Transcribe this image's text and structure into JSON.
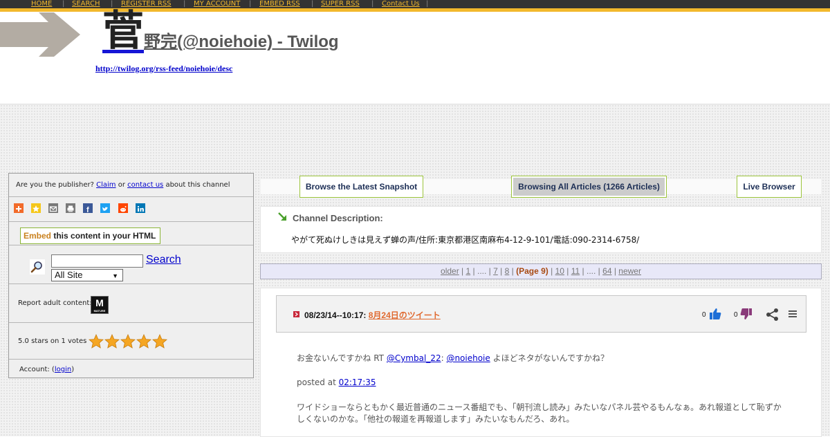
{
  "nav": {
    "items": [
      "HOME",
      "SEARCH",
      "REGISTER RSS",
      "MY ACCOUNT",
      "EMBED RSS",
      "SUPER RSS",
      "Contact Us"
    ]
  },
  "header": {
    "title_big_char": "菅",
    "title_rest": "野完(@noiehoie) - Twilog",
    "rss_url": "http://twilog.org/rss-feed/noiehoie/desc"
  },
  "sidebar": {
    "publisher_prefix": "Are you the publisher? ",
    "claim_link": "Claim",
    "or_text": " or ",
    "contact_link": "contact us",
    "publisher_suffix": " about this channel",
    "embed_word": "Embed",
    "embed_rest": " this content in your HTML",
    "search_value": "",
    "search_label": "Search",
    "site_select_value": "All Site",
    "report_label": "Report adult content:",
    "mature_label": "M",
    "mature_small": "MATURE",
    "rating_text": "5.0 stars on 1 votes",
    "rating_value": 5,
    "account_prefix": "Account: (",
    "account_link": "login",
    "account_suffix": ")"
  },
  "tabs": {
    "snapshot": "Browse the Latest Snapshot",
    "all_articles": "Browsing All Articles (1266 Articles)",
    "live_browser": "Live Browser"
  },
  "channel": {
    "title": "Channel Description:",
    "description": "やがて死ぬけしきは見えず蝉の声/住所:東京都港区南麻布4-12-9-101/電話:090-2314-6758/"
  },
  "pager": {
    "older": "older",
    "p1": "1",
    "ellipsis1": "....",
    "p7": "7",
    "p8": "8",
    "current": "(Page 9)",
    "p10": "10",
    "p11": "11",
    "ellipsis2": "....",
    "p64": "64",
    "newer": "newer"
  },
  "article": {
    "date": "08/23/14--10:17: ",
    "title": "8月24日のツイート",
    "likes": "0",
    "dislikes": "0",
    "tweet1_prefix": "お金ないんですかね RT ",
    "tweet1_user1": "@Cymbal_22",
    "tweet1_sep": ": ",
    "tweet1_user2": "@noiehoie",
    "tweet1_suffix": " よほどネタがないんですかね？",
    "posted_at_label": "posted at ",
    "posted_time": "02:17:35",
    "tweet2_line1": "ワイドショーならともかく最近普通のニュース番組でも、「朝刊流し読み」みたいなパネル芸やるもんなぁ。あれ報道として恥ずか",
    "tweet2_line2": "しくないのかな。「他社の報道を再報道します」みたいなもんだろ、あれ。"
  },
  "colors": {
    "nav_bg": "#333333",
    "accent_yellow": "#f2b82c",
    "link_blue": "#0000cc",
    "article_link": "#e0692f",
    "tab_border": "#9bc43a"
  }
}
